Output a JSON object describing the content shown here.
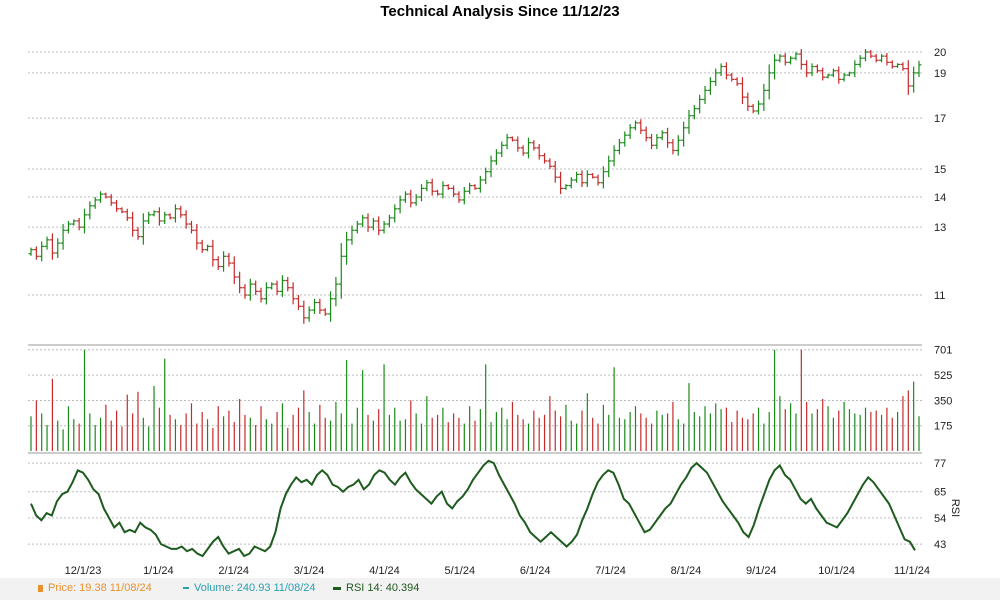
{
  "title": "Technical Analysis Since 11/12/23",
  "legend": {
    "price": "Price: 19.38  11/08/24",
    "volume": "Volume: 240.93  11/08/24",
    "rsi": "RSI 14: 40.394"
  },
  "colors": {
    "up": "#1a8a1a",
    "down": "#c62a2a",
    "rsi_line": "#1e5b1e",
    "price_label": "#e8912e",
    "volume_label": "#2a9fb0",
    "grid": "#bdbdbd"
  },
  "chart_data": [
    {
      "type": "ohlc",
      "title": "Technical Analysis Since 11/12/23",
      "ylabel": "",
      "y_scale": "log",
      "ylim": [
        9.8,
        20.5
      ],
      "y_ticks": [
        11,
        13,
        14,
        15,
        17,
        19,
        20
      ],
      "x_tick_labels": [
        "12/1/23",
        "1/1/24",
        "2/1/24",
        "3/1/24",
        "4/1/24",
        "5/1/24",
        "6/1/24",
        "7/1/24",
        "8/1/24",
        "9/1/24",
        "10/1/24",
        "11/1/24"
      ],
      "closes": [
        12.3,
        12.1,
        12.4,
        12.6,
        12.2,
        12.5,
        12.9,
        13.1,
        13.2,
        13.0,
        13.4,
        13.7,
        13.9,
        14.1,
        14.0,
        13.8,
        13.6,
        13.5,
        13.3,
        12.9,
        12.7,
        13.2,
        13.4,
        13.5,
        13.2,
        13.4,
        13.3,
        13.6,
        13.4,
        13.1,
        12.9,
        12.5,
        12.3,
        12.4,
        12.0,
        11.8,
        12.1,
        11.9,
        11.5,
        11.2,
        11.0,
        11.3,
        11.1,
        10.9,
        11.2,
        11.3,
        11.1,
        11.4,
        11.2,
        10.9,
        10.7,
        10.4,
        10.6,
        10.8,
        10.6,
        10.5,
        10.9,
        11.3,
        12.1,
        12.6,
        12.9,
        13.1,
        13.3,
        13.0,
        13.2,
        12.9,
        13.1,
        13.3,
        13.6,
        13.9,
        14.1,
        13.8,
        14.0,
        14.3,
        14.5,
        14.2,
        14.1,
        14.4,
        14.3,
        14.1,
        13.9,
        14.2,
        14.4,
        14.3,
        14.6,
        14.9,
        15.3,
        15.6,
        15.9,
        16.2,
        16.1,
        15.8,
        15.6,
        16.0,
        15.8,
        15.5,
        15.3,
        15.1,
        14.7,
        14.3,
        14.4,
        14.6,
        14.8,
        14.5,
        14.8,
        14.7,
        14.5,
        14.9,
        15.3,
        15.7,
        16.0,
        16.3,
        16.6,
        16.8,
        16.5,
        16.2,
        15.9,
        16.2,
        16.4,
        16.0,
        15.7,
        16.1,
        16.6,
        17.1,
        17.4,
        17.8,
        18.2,
        18.6,
        19.0,
        19.3,
        18.9,
        18.7,
        18.5,
        17.9,
        17.5,
        17.3,
        17.6,
        18.2,
        19.0,
        19.6,
        19.8,
        19.5,
        19.7,
        19.9,
        19.4,
        19.0,
        19.3,
        19.1,
        18.8,
        18.9,
        19.1,
        18.7,
        18.9,
        19.0,
        19.4,
        19.7,
        20.0,
        19.8,
        19.6,
        19.8,
        19.5,
        19.3,
        19.4,
        19.2,
        18.4,
        19.0,
        19.38
      ],
      "volume": {
        "ylim": [
          0,
          720
        ],
        "y_ticks": [
          175,
          350,
          525,
          701
        ],
        "values": [
          240,
          350,
          260,
          180,
          500,
          210,
          150,
          310,
          220,
          190,
          701,
          260,
          180,
          230,
          320,
          210,
          280,
          170,
          390,
          260,
          410,
          230,
          170,
          450,
          300,
          640,
          250,
          220,
          180,
          260,
          330,
          190,
          270,
          220,
          160,
          310,
          240,
          280,
          200,
          360,
          250,
          230,
          180,
          310,
          220,
          190,
          270,
          330,
          160,
          250,
          300,
          420,
          270,
          190,
          320,
          230,
          210,
          340,
          260,
          630,
          190,
          300,
          560,
          250,
          210,
          290,
          600,
          250,
          300,
          210,
          220,
          350,
          260,
          190,
          380,
          230,
          250,
          300,
          200,
          260,
          230,
          190,
          310,
          210,
          290,
          600,
          200,
          270,
          300,
          220,
          340,
          250,
          220,
          190,
          280,
          230,
          250,
          380,
          280,
          240,
          320,
          210,
          190,
          280,
          400,
          230,
          190,
          320,
          250,
          580,
          230,
          220,
          270,
          310,
          260,
          230,
          190,
          280,
          250,
          260,
          340,
          220,
          190,
          470,
          270,
          240,
          310,
          260,
          330,
          290,
          300,
          200,
          280,
          230,
          220,
          260,
          300,
          190,
          270,
          701,
          380,
          290,
          330,
          260,
          701,
          340,
          260,
          290,
          360,
          310,
          230,
          280,
          340,
          290,
          260,
          250,
          300,
          270,
          280,
          250,
          300,
          230,
          270,
          380,
          420,
          480,
          240.93
        ]
      },
      "rsi": {
        "ylim": [
          38,
          80
        ],
        "y_ticks": [
          43,
          54,
          65,
          77
        ],
        "ylabel": "RSI",
        "values": [
          60,
          55,
          53,
          56,
          55,
          61,
          64,
          65,
          69,
          74,
          73,
          70,
          66,
          64,
          58,
          54,
          50,
          52,
          48,
          49,
          48,
          52,
          50,
          49,
          47,
          43,
          42,
          41,
          41,
          42,
          40,
          41,
          39,
          38,
          41,
          44,
          46,
          42,
          39,
          40,
          41,
          38,
          39,
          42,
          41,
          40,
          42,
          48,
          58,
          64,
          68,
          71,
          69,
          70,
          68,
          72,
          74,
          72,
          68,
          67,
          65,
          67,
          68,
          70,
          66,
          68,
          72,
          74,
          73,
          70,
          68,
          71,
          73,
          69,
          66,
          64,
          62,
          60,
          63,
          65,
          60,
          58,
          61,
          63,
          66,
          70,
          73,
          76,
          78,
          77,
          72,
          68,
          64,
          60,
          55,
          52,
          48,
          46,
          44,
          46,
          48,
          46,
          44,
          42,
          44,
          47,
          53,
          58,
          64,
          69,
          72,
          74,
          73,
          68,
          62,
          60,
          56,
          52,
          48,
          49,
          52,
          55,
          58,
          60,
          64,
          68,
          71,
          75,
          77,
          75,
          73,
          69,
          65,
          61,
          58,
          55,
          52,
          48,
          46,
          51,
          58,
          64,
          70,
          74,
          76,
          72,
          70,
          66,
          62,
          60,
          62,
          58,
          55,
          52,
          51,
          50,
          53,
          56,
          60,
          64,
          68,
          71,
          69,
          66,
          63,
          60,
          55,
          50,
          45,
          44,
          40.394
        ]
      }
    }
  ]
}
